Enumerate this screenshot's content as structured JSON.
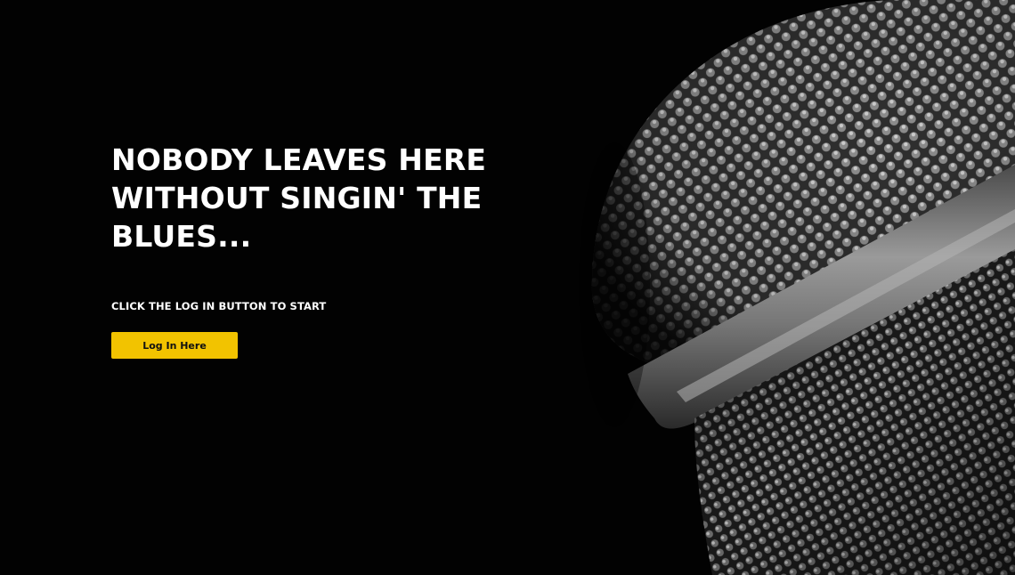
{
  "hero": {
    "headline": "NOBODY LEAVES HERE WITHOUT SINGIN' THE BLUES...",
    "subtext": "CLICK THE LOG IN BUTTON TO START",
    "login_label": "Log In Here"
  },
  "colors": {
    "background": "#000000",
    "headline": "#ffffff",
    "button_bg": "#f2c300",
    "button_text": "#111111"
  },
  "icons": {
    "background_image": "microphone-grille-photo"
  }
}
